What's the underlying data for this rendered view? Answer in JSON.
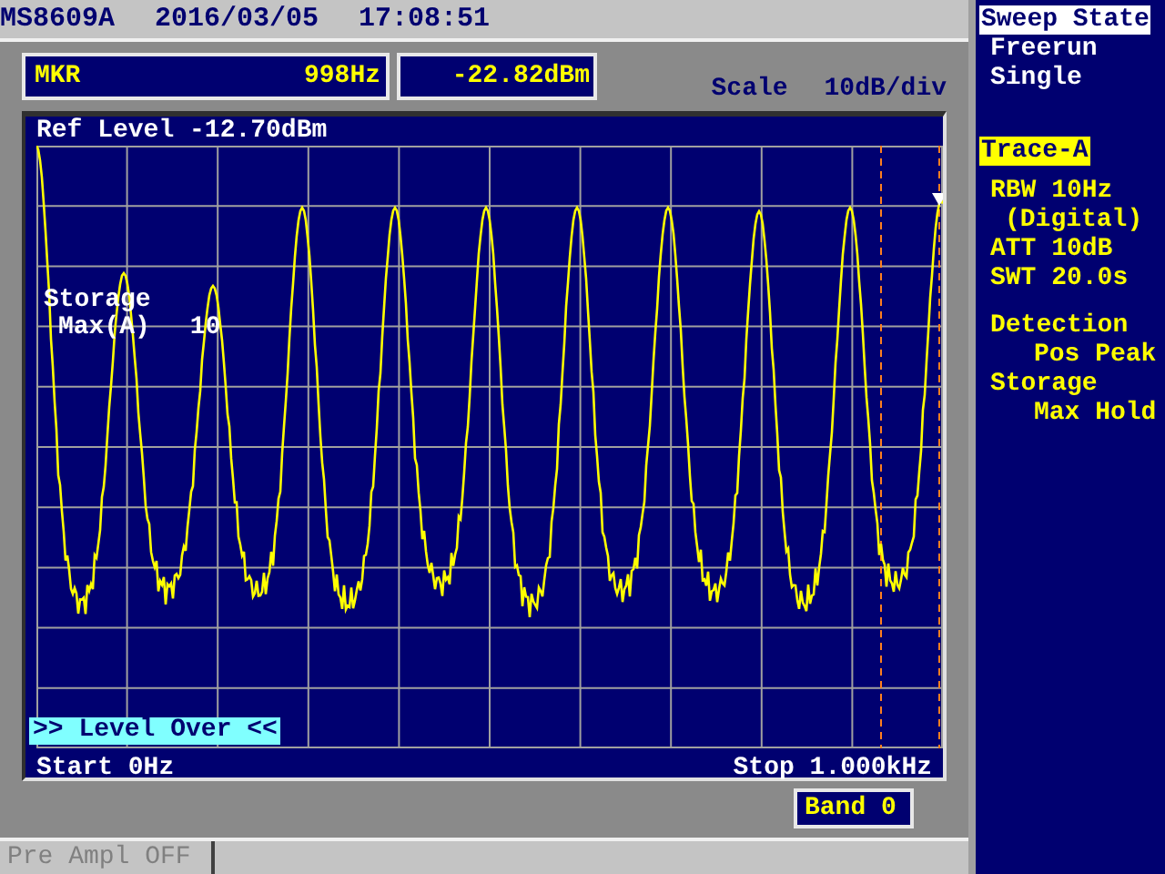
{
  "header": {
    "model": "MS8609A",
    "date": "2016/03/05",
    "time": "17:08:51"
  },
  "marker": {
    "label": "MKR",
    "frequency": "998Hz",
    "level": "-22.82dBm"
  },
  "scale": {
    "label": "Scale",
    "value": "10dB/div"
  },
  "plot": {
    "ref_level": "Ref Level -12.70dBm",
    "storage_title": "Storage",
    "storage_mode": "Max(A)",
    "storage_count": "10",
    "warning": ">> Level Over <<",
    "start": "Start 0Hz",
    "stop": "Stop 1.000kHz"
  },
  "band": "Band 0",
  "pre_ampl": {
    "label": "Pre Ampl OFF",
    "disabled": true
  },
  "sidebar": {
    "menu_title": "Sweep State",
    "menu_items": [
      {
        "label": "Freerun"
      },
      {
        "label": "Single"
      }
    ],
    "trace": "Trace-A",
    "settings": [
      {
        "name": "RBW 10Hz",
        "detail": "(Digital)"
      },
      {
        "name": "ATT 10dB"
      },
      {
        "name": "SWT 20.0s"
      }
    ],
    "modes": [
      {
        "name": "Detection",
        "value": "Pos Peak"
      },
      {
        "name": "Storage",
        "value": "Max Hold"
      }
    ]
  }
}
